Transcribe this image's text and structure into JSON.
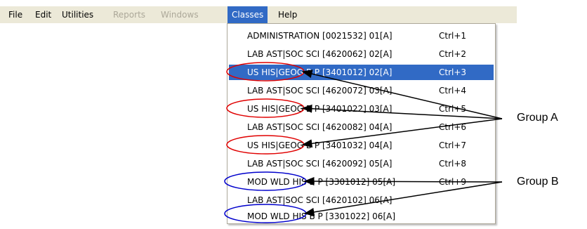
{
  "menubar": {
    "items": [
      {
        "label": "File",
        "state": "normal"
      },
      {
        "label": "Edit",
        "state": "normal"
      },
      {
        "label": "Utilities",
        "state": "normal"
      },
      {
        "label": "Reports",
        "state": "disabled"
      },
      {
        "label": "Windows",
        "state": "disabled"
      },
      {
        "label": "Classes",
        "state": "active"
      },
      {
        "label": "Help",
        "state": "normal"
      }
    ]
  },
  "classes_menu": {
    "items": [
      {
        "label": "ADMINISTRATION [0021532]  01[A]",
        "shortcut": "Ctrl+1",
        "selected": false
      },
      {
        "label": "LAB AST|SOC SCI [4620062]  02[A]",
        "shortcut": "Ctrl+2",
        "selected": false
      },
      {
        "label": "US HIS|GEOG B P [3401012]  02[A]",
        "shortcut": "Ctrl+3",
        "selected": true
      },
      {
        "label": "LAB AST|SOC SCI [4620072]  03[A]",
        "shortcut": "Ctrl+4",
        "selected": false
      },
      {
        "label": "US HIS|GEOG B P [3401022]  03[A]",
        "shortcut": "Ctrl+5",
        "selected": false
      },
      {
        "label": "LAB AST|SOC SCI [4620082]  04[A]",
        "shortcut": "Ctrl+6",
        "selected": false
      },
      {
        "label": "US HIS|GEOG B P [3401032]  04[A]",
        "shortcut": "Ctrl+7",
        "selected": false
      },
      {
        "label": "LAB AST|SOC SCI [4620092]  05[A]",
        "shortcut": "Ctrl+8",
        "selected": false
      },
      {
        "label": "MOD WLD HIS B P [3301012]  05[A]",
        "shortcut": "Ctrl+9",
        "selected": false
      },
      {
        "label": "LAB AST|SOC SCI [4620102]  06[A]",
        "shortcut": "",
        "selected": false
      },
      {
        "label": "MOD WLD HIS B P [3301022]  06[A]",
        "shortcut": "",
        "selected": false
      }
    ]
  },
  "annotations": {
    "group_a_label": "Group A",
    "group_b_label": "Group B",
    "group_a_color": "#e00000",
    "group_b_color": "#0000cc",
    "arrow_color": "#000000"
  },
  "colors": {
    "menubar_bg": "#ece9d8",
    "highlight": "#316ac5",
    "disabled_text": "#aca899"
  }
}
